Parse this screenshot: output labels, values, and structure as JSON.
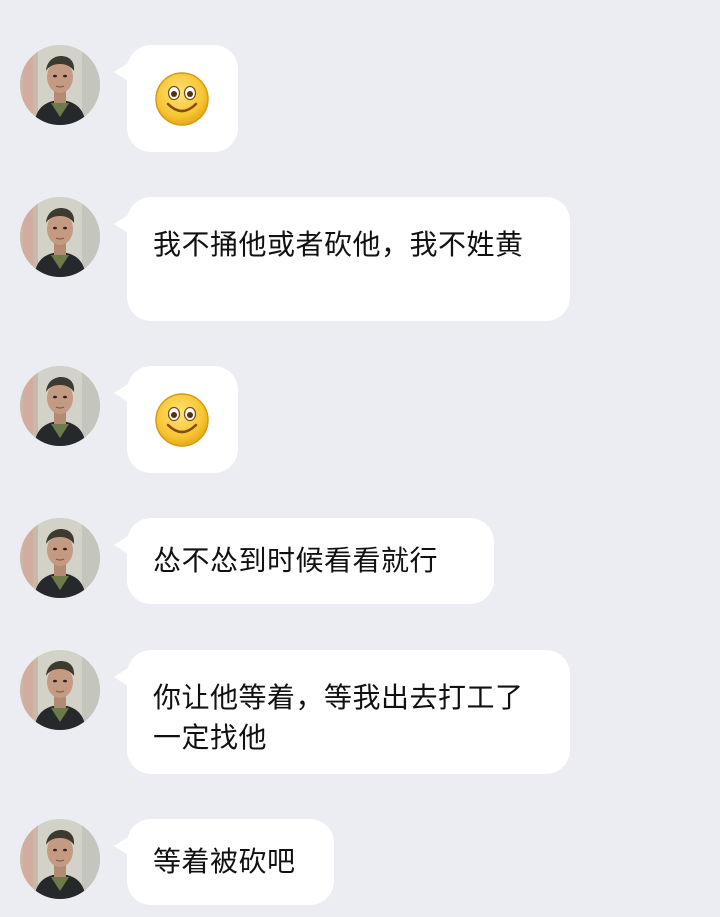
{
  "chat": {
    "messages": [
      {
        "type": "emoji",
        "icon": "smile-emoji-icon"
      },
      {
        "type": "text",
        "text": "我不捅他或者砍他，我不姓黄"
      },
      {
        "type": "emoji",
        "icon": "smile-emoji-icon"
      },
      {
        "type": "text",
        "text": "怂不怂到时候看看就行"
      },
      {
        "type": "text",
        "text": "你让他等着，等我出去打工了一定找他"
      },
      {
        "type": "text",
        "text": "等着被砍吧"
      }
    ]
  },
  "colors": {
    "background": "#ebedf2",
    "bubble": "#ffffff",
    "text": "#111111",
    "emoji_face": "#f7c530"
  }
}
